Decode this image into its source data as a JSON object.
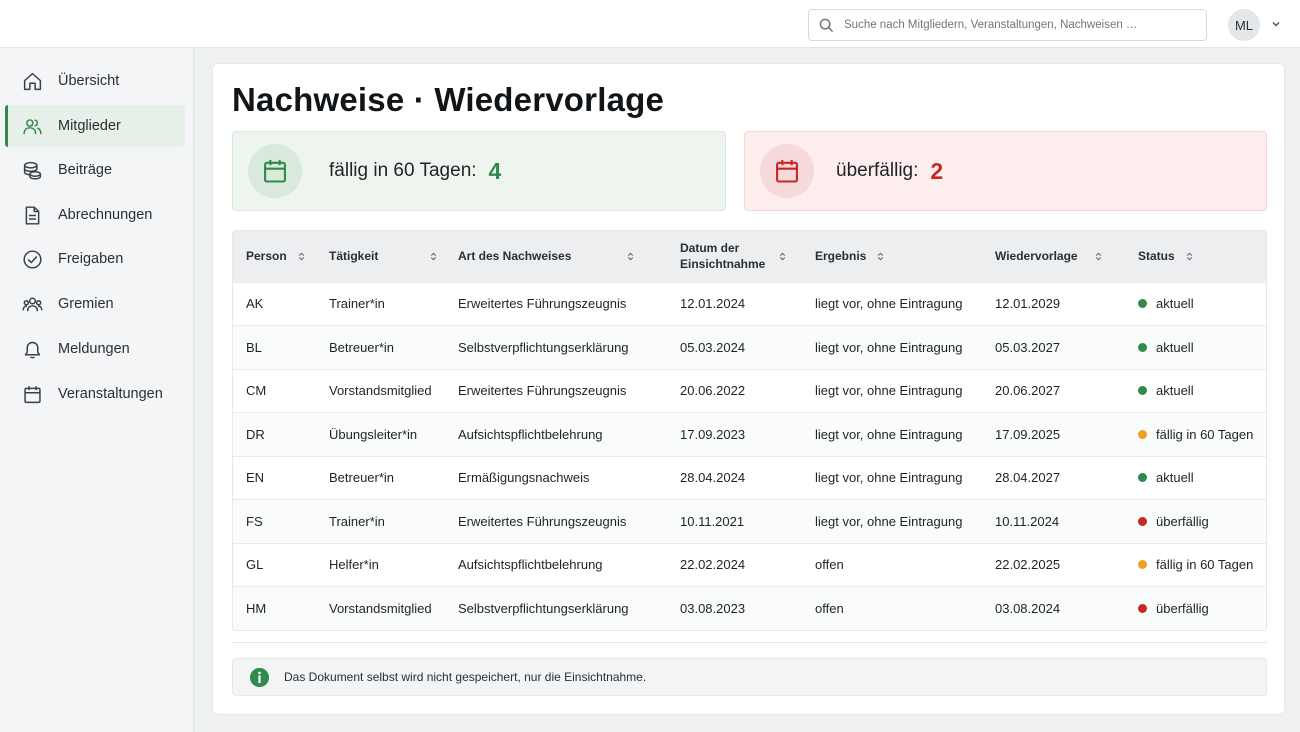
{
  "topbar": {
    "search_placeholder": "Suche nach Mitgliedern, Veranstaltungen, Nachweisen …",
    "avatar_initials": "ML"
  },
  "sidebar": {
    "items": [
      {
        "label": "Übersicht",
        "icon": "home-icon"
      },
      {
        "label": "Mitglieder",
        "icon": "users-icon",
        "active": true
      },
      {
        "label": "Beiträge",
        "icon": "coins-icon"
      },
      {
        "label": "Abrechnungen",
        "icon": "document-icon"
      },
      {
        "label": "Freigaben",
        "icon": "check-circle-icon"
      },
      {
        "label": "Gremien",
        "icon": "group-icon"
      },
      {
        "label": "Meldungen",
        "icon": "bell-icon"
      },
      {
        "label": "Veranstaltungen",
        "icon": "calendar-icon"
      }
    ]
  },
  "main": {
    "title": "Nachweise · Wiedervorlage",
    "stats": {
      "due": {
        "label": "fällig in 60 Tagen:",
        "value": "4"
      },
      "overdue": {
        "label": "überfällig:",
        "value": "2"
      }
    },
    "table": {
      "headers": [
        "Person",
        "Tätigkeit",
        "Art des Nachweises",
        "Datum der Einsichtnahme",
        "Ergebnis",
        "Wiedervorlage",
        "Status"
      ],
      "rows": [
        [
          "AK",
          "Trainer*in",
          "Erweitertes Führungszeugnis",
          "12.01.2024",
          "liegt vor, ohne Eintragung",
          "12.01.2029",
          "aktuell"
        ],
        [
          "BL",
          "Betreuer*in",
          "Selbstverpflichtungserklärung",
          "05.03.2024",
          "liegt vor, ohne Eintragung",
          "05.03.2027",
          "aktuell"
        ],
        [
          "CM",
          "Vorstandsmitglied",
          "Erweitertes Führungszeugnis",
          "20.06.2022",
          "liegt vor, ohne Eintragung",
          "20.06.2027",
          "aktuell"
        ],
        [
          "DR",
          "Übungsleiter*in",
          "Aufsichtspflichtbelehrung",
          "17.09.2023",
          "liegt vor, ohne Eintragung",
          "17.09.2025",
          "fällig in 60 Tagen"
        ],
        [
          "EN",
          "Betreuer*in",
          "Ermäßigungsnachweis",
          "28.04.2024",
          "liegt vor, ohne Eintragung",
          "28.04.2027",
          "aktuell"
        ],
        [
          "FS",
          "Trainer*in",
          "Erweitertes Führungszeugnis",
          "10.11.2021",
          "liegt vor, ohne Eintragung",
          "10.11.2024",
          "überfällig"
        ],
        [
          "GL",
          "Helfer*in",
          "Aufsichtspflichtbelehrung",
          "22.02.2024",
          "offen",
          "22.02.2025",
          "fällig in 60 Tagen"
        ],
        [
          "HM",
          "Vorstandsmitglied",
          "Selbstverpflichtungserklärung",
          "03.08.2023",
          "offen",
          "03.08.2024",
          "überfällig"
        ]
      ]
    },
    "status_colors": {
      "aktuell": "#2f8a4c",
      "fällig in 60 Tagen": "#f0a020",
      "überfällig": "#c62828"
    },
    "note": "Das Dokument selbst wird nicht gespeichert, nur die Einsichtnahme."
  }
}
